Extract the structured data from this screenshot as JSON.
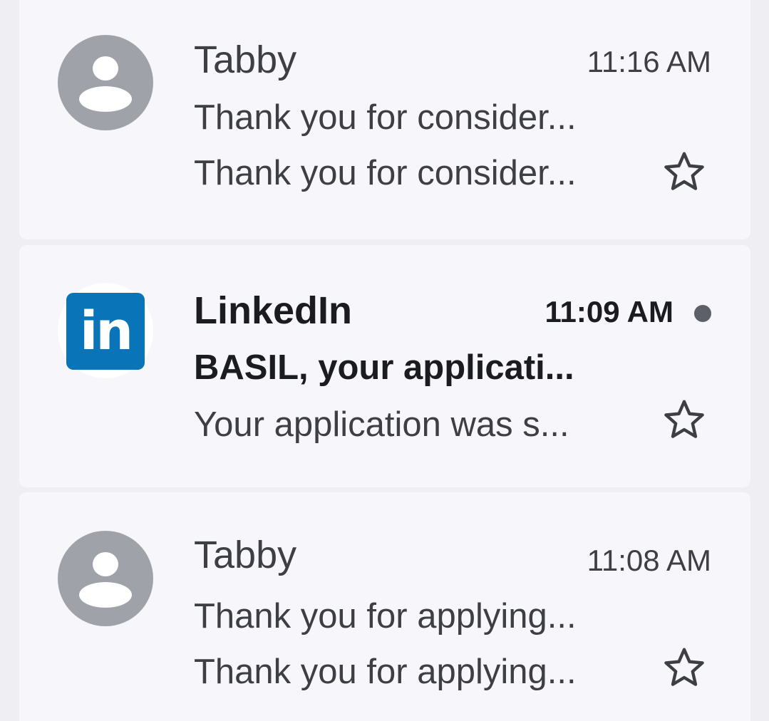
{
  "emails": [
    {
      "sender": "Tabby",
      "time": "11:16 AM",
      "subject": "Thank you for consider...",
      "snippet": "Thank you for consider...",
      "avatar": "person-icon",
      "unread": false,
      "starred": false
    },
    {
      "sender": "LinkedIn",
      "time": "11:09 AM",
      "subject": "BASIL, your applicati...",
      "snippet": "Your application was s...",
      "avatar": "linkedin-logo",
      "logo_text": "in",
      "unread": true,
      "starred": false
    },
    {
      "sender": "Tabby",
      "time": "11:08 AM",
      "subject": "Thank you for applying...",
      "snippet": "Thank you for applying...",
      "avatar": "person-icon",
      "unread": false,
      "starred": false
    }
  ],
  "colors": {
    "background": "#eeeef3",
    "card": "#f7f6fb",
    "avatar_gray": "#9fa3a9",
    "linkedin_blue": "#0a74b8",
    "text_read": "#3d3f45",
    "text_unread": "#1b1c20",
    "unread_dot": "#5d6068"
  },
  "icons": {
    "star": "star-outline-icon"
  }
}
